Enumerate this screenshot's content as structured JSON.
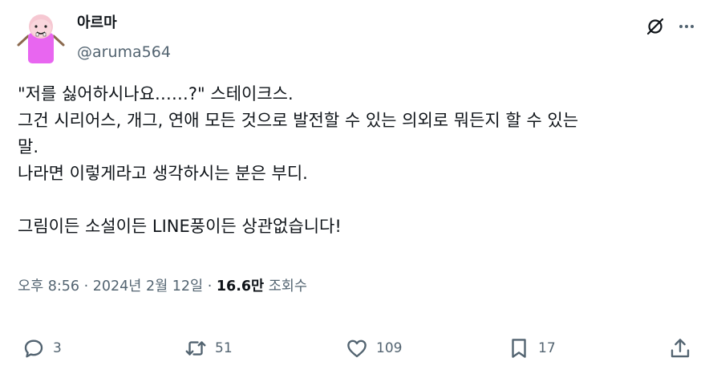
{
  "author": {
    "display_name": "아르마",
    "handle": "@aruma564"
  },
  "tweet": {
    "lines": [
      "\"저를 싫어하시나요……?\" 스테이크스.",
      "그건 시리어스, 개그, 연애 모든 것으로 발전할 수 있는 의외로 뭐든지 할 수 있는",
      "말.",
      "나라면 이렇게라고 생각하시는 분은 부디.",
      "",
      "그림이든 소설이든 LINE풍이든 상관없습니다!"
    ]
  },
  "meta": {
    "time": "오후 8:56",
    "separator": " · ",
    "date": "2024년 2월 12일",
    "views_count": "16.6만",
    "views_label": " 조회수"
  },
  "actions": {
    "replies": "3",
    "reposts": "51",
    "likes": "109",
    "bookmarks": "17"
  },
  "icons": [
    "grok-icon",
    "more-icon",
    "reply-icon",
    "repost-icon",
    "like-icon",
    "bookmark-icon",
    "share-icon"
  ],
  "colors": {
    "text": "#0f1419",
    "secondary": "#536471",
    "avatar_body": "#e866f0"
  }
}
